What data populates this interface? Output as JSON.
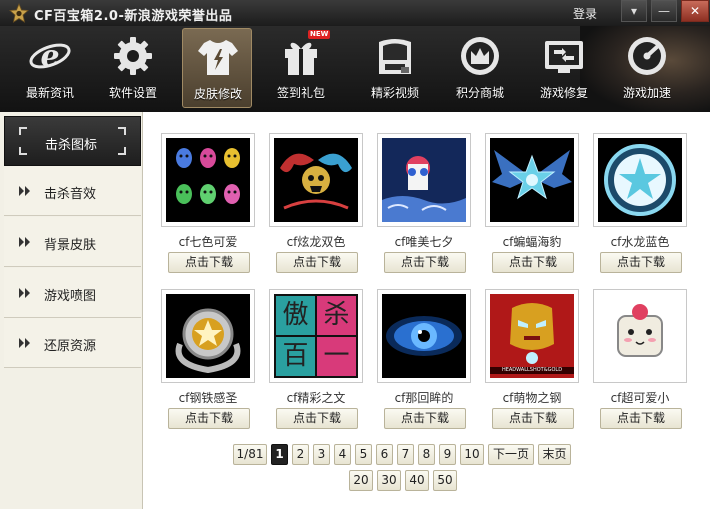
{
  "window": {
    "title": "CF百宝箱2.0-新浪游戏荣誉出品",
    "login_label": "登录",
    "menu_glyph": "▾",
    "minimize_glyph": "—",
    "close_glyph": "✕"
  },
  "toolbar": {
    "items": [
      {
        "label": "最新资讯",
        "icon": "ie-logo-icon"
      },
      {
        "label": "软件设置",
        "icon": "gear-icon"
      },
      {
        "label": "皮肤修改",
        "icon": "tshirt-icon",
        "active": true
      },
      {
        "label": "签到礼包",
        "icon": "gift-icon",
        "badge": "NEW"
      },
      {
        "label": "精彩视频",
        "icon": "video-icon"
      },
      {
        "label": "积分商城",
        "icon": "shop-icon"
      },
      {
        "label": "游戏修复",
        "icon": "repair-icon"
      },
      {
        "label": "游戏加速",
        "icon": "accelerate-icon"
      }
    ]
  },
  "sidebar": {
    "items": [
      {
        "label": "击杀图标",
        "active": true
      },
      {
        "label": "击杀音效"
      },
      {
        "label": "背景皮肤"
      },
      {
        "label": "游戏喷图"
      },
      {
        "label": "还原资源"
      }
    ]
  },
  "skins": {
    "download_label": "点击下载",
    "items": [
      {
        "name": "cf七色可爱"
      },
      {
        "name": "cf炫龙双色"
      },
      {
        "name": "cf唯美七夕"
      },
      {
        "name": "cf蝙蝠海豹"
      },
      {
        "name": "cf水龙蓝色"
      },
      {
        "name": "cf钢铁感圣"
      },
      {
        "name": "cf精彩之文",
        "thumb_text": [
          "傲",
          "杀",
          "百",
          "一"
        ]
      },
      {
        "name": "cf那回眸的"
      },
      {
        "name": "cf萌物之钢",
        "thumb_text": [
          "HEADWALLSHOT&GOLD"
        ]
      },
      {
        "name": "cf超可爱小"
      }
    ]
  },
  "pagination": {
    "page_info": "1/81",
    "pages": [
      "1",
      "2",
      "3",
      "4",
      "5",
      "6",
      "7",
      "8",
      "9",
      "10"
    ],
    "current": "1",
    "next_label": "下一页",
    "last_label": "末页",
    "page_sizes": [
      "20",
      "30",
      "40",
      "50"
    ]
  },
  "colors": {
    "titlebar": "#2a2a2a",
    "toolbar_active": "#6b5b44",
    "sidebar_bg": "#f2f0e6",
    "button_border": "#b9b39a",
    "close_button": "#b14a3a"
  }
}
